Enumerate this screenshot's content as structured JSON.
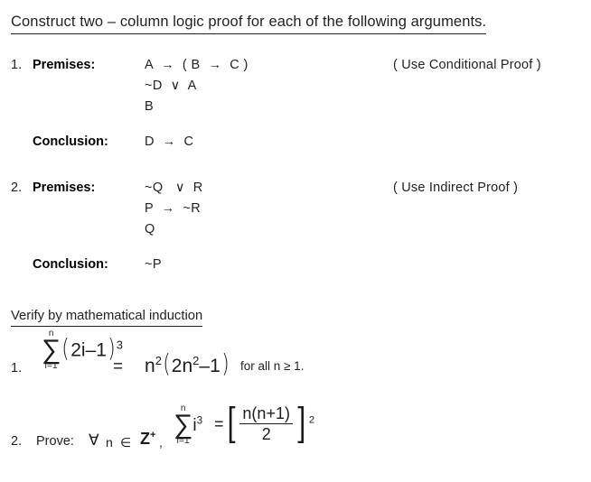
{
  "document": {
    "title": "Construct two – column logic proof for each of the following arguments.",
    "background_color": "#ffffff",
    "text_color": "#231f20"
  },
  "logic_problems": [
    {
      "number": "1.",
      "premises_label": "Premises:",
      "premises": [
        "A  →  ( B  →  C )",
        "~D  ∨  A",
        "B"
      ],
      "conclusion_label": "Conclusion:",
      "conclusion": "D  →  C",
      "note": "( Use Conditional Proof )"
    },
    {
      "number": "2.",
      "premises_label": "Premises:",
      "premises": [
        "~Q   ∨  R",
        "P  →  ~R",
        "Q"
      ],
      "conclusion_label": "Conclusion:",
      "conclusion": "~P",
      "note": "( Use Indirect Proof )"
    }
  ],
  "induction": {
    "heading": "Verify by mathematical induction",
    "items": [
      {
        "number": "1.",
        "sum_upper": "n",
        "sum_lower": "i=1",
        "sigma": "∑",
        "summand_open": "(",
        "summand_body": "2i",
        "summand_minus": "–",
        "summand_one": "1",
        "summand_close": ")",
        "summand_exp": "3",
        "equals": "=",
        "rhs_base": "n",
        "rhs_base_exp": "2",
        "rhs_open": "(",
        "rhs_inner": "2n",
        "rhs_inner_exp": "2",
        "rhs_minus": "–",
        "rhs_one": "1",
        "rhs_close": ")",
        "tail": "for all n ≥ 1."
      },
      {
        "number": "2.",
        "prove_label": "Prove:",
        "forall": "∀",
        "variable": "n",
        "member": "∈",
        "set": "Z",
        "set_exp": "+",
        "comma": ",",
        "sum_upper": "n",
        "sum_lower": "i=1",
        "sigma": "∑",
        "summand": "i",
        "summand_exp": "3",
        "equals": "=",
        "bracket_left": "[",
        "fraction_numerator": "n(n+1)",
        "fraction_denominator": "2",
        "bracket_right": "]",
        "bracket_exp": "2"
      }
    ]
  }
}
